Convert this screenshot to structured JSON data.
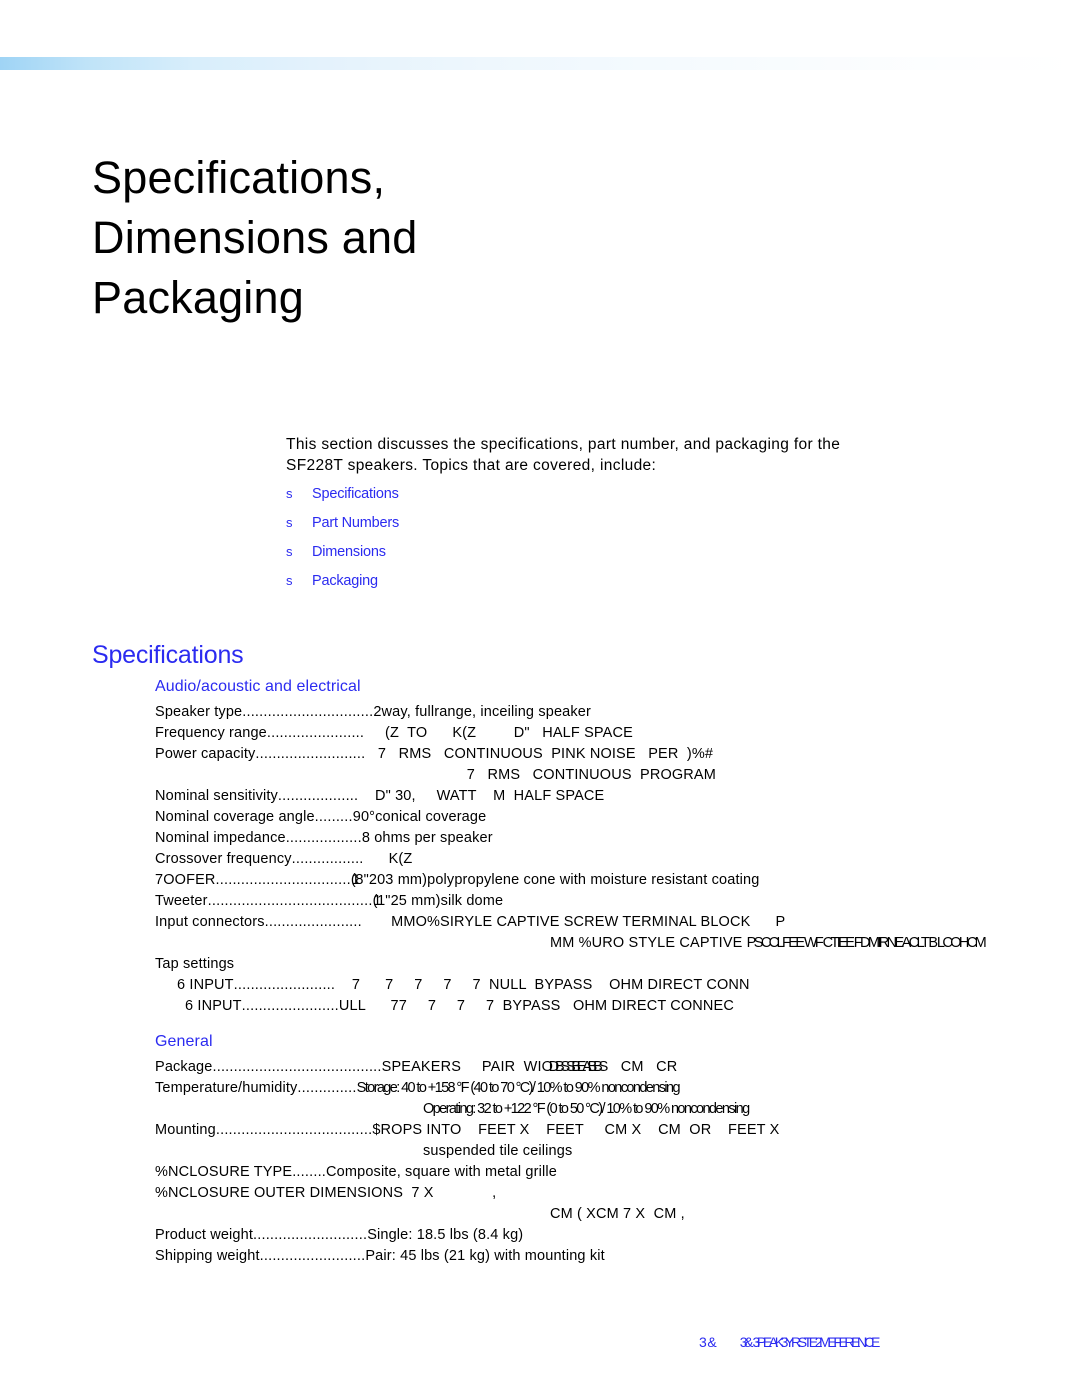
{
  "document": {
    "title_lines": [
      "Specifications,",
      "Dimensions and",
      "Packaging"
    ],
    "intro_lines": [
      "This section discusses the specifications, part number, and packaging for the",
      "SF228T speakers. Topics that are covered, include:"
    ],
    "bullet_glyph": "s",
    "topics": [
      {
        "label": "Specifications"
      },
      {
        "label": "Part Numbers"
      },
      {
        "label": "Dimensions"
      },
      {
        "label": "Packaging"
      }
    ],
    "specifications_heading": "Specifications"
  },
  "audio_section": {
    "heading": "Audio/acoustic and electrical",
    "rows": [
      {
        "label": "Speaker type",
        "dots": "...............................",
        "value": "2way, fullrange, inceiling speaker"
      },
      {
        "label": "Frequency range",
        "dots": ".......................",
        "value": "     (Z  TO      K(Z         D\"   HALF SPACE"
      },
      {
        "label": "Power capacity",
        "dots": "..........................",
        "value": "   7   RMS   CONTINUOUS  PINK NOISE   PER  )%#"
      },
      {
        "label": "Nominal sensitivity",
        "dots": "...................",
        "value": "    D\" 30,     WATT    M  HALF SPACE"
      },
      {
        "label": "Nominal coverage angle",
        "dots": ".........",
        "value": "90°conical coverage"
      },
      {
        "label": "Nominal impedance",
        "dots": "..................",
        "value": "8 ohms per speaker"
      },
      {
        "label": "Crossover frequency",
        "dots": ".................",
        "value": "      K(Z"
      },
      {
        "label": "7OOFER",
        "dots": "................................",
        "value": "8\"203 mm)polypropylene cone with moisture resistant coating",
        "value_overlap": "(1",
        "label_overlap": true
      },
      {
        "label": "Tweeter",
        "dots": ".......................................",
        "value": "1\"25 mm)silk dome",
        "value_overlap": "(1"
      },
      {
        "label": "Input connectors",
        "dots": ".......................",
        "value": "       MMO%SIRYLE CAPTIVE SCREW TERMINAL BLOCK      P"
      }
    ],
    "power_continuation": "    7   RMS   CONTINUOUS  PROGRAM",
    "input_continuation_prefix": "MM %URO STYLE CAPTIVE ",
    "input_continuation_garbled": "PSCCLFEE WF CTIEE FDMIRNEACLT B LCOHCM",
    "tap_settings_label": "Tap settings",
    "tap_rows": [
      {
        "label": "6 INPUT",
        "dots": "........................",
        "value": "    7      7     7     7     7  NULL  BYPASS    OHM DIRECT CONN"
      },
      {
        "label": "6 INPUT",
        "dots": ".......................",
        "value": "ULL      77     7     7     7  BYPASS   OHM DIRECT CONNEC"
      }
    ]
  },
  "general_section": {
    "heading": "General",
    "rows": [
      {
        "label": "Package",
        "dots": "........................................",
        "value": "SPEAKERS     PAIR  WI",
        "value_overlap": "ODBSS BEABBS",
        "value_tail": "    CM   CR"
      },
      {
        "label": "Temperature/humidity",
        "dots": "..............",
        "value": "Storage: 40 to +158 °F (40 to 70 °C)/ 10% to 90% noncondensing"
      },
      {
        "label": "Mounting",
        "dots": ".....................................",
        "value": "$ROPS INTO    FEET X    FEET     CM X    CM  OR    FEET X"
      },
      {
        "label": "%NCLOSURE TYPE",
        "dots": "........",
        "value": "Composite, square with metal grille"
      },
      {
        "label": "%NCLOSURE OUTER DIMENSIONS",
        "dots": "",
        "value": "  7 X              ,"
      },
      {
        "label": "Product weight",
        "dots": "...........................",
        "value": "Single: 18.5 lbs (8.4 kg)"
      },
      {
        "label": "Shipping weight",
        "dots": ".........................",
        "value": "Pair: 45 lbs (21 kg) with mounting kit"
      }
    ],
    "temperature_continuation": "Operating: 32 to +122 °F (0 to 50 °C)/ 10% to 90% noncondensing",
    "mounting_continuation": "suspended tile ceilings",
    "enclosure_dimensions_continuation": "CM ( XCM 7 X  CM ,"
  },
  "footer": {
    "page_prefix": "3&",
    "text_a": "3PEAKER",
    "text_b": "3YSTEM",
    "text_c": "2EFERENCE",
    "full": "3&     3PEAK3YRSTE2MEFERENICE"
  },
  "colors": {
    "accent_blue": "#2b2bf0",
    "text_black": "#000000",
    "rule_blue": "#9fd4f5",
    "page_background": "#ffffff"
  }
}
